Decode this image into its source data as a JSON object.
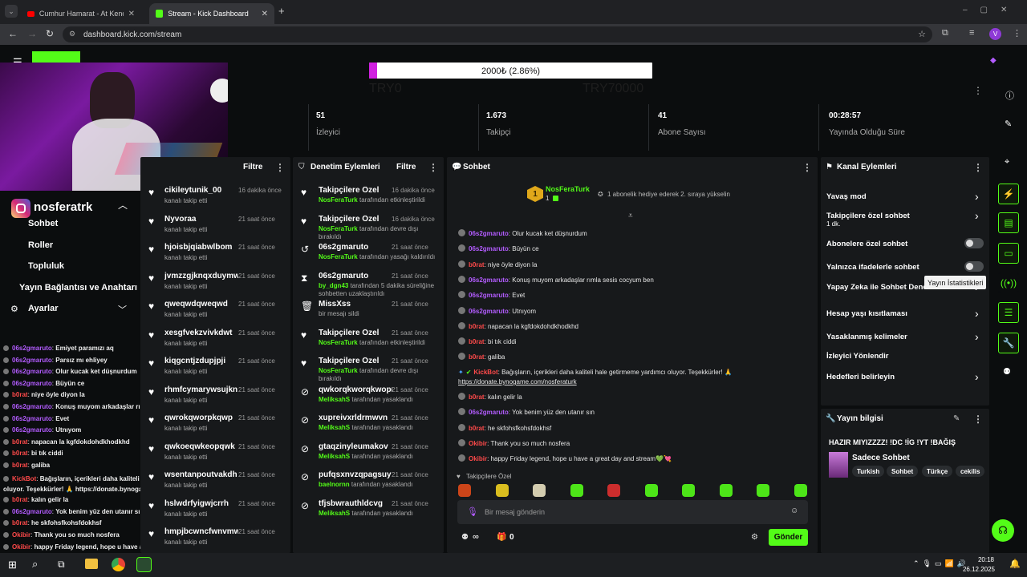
{
  "browser": {
    "tabs": [
      {
        "title": "Cumhur Hamarat - At Kendini D"
      },
      {
        "title": "Stream - Kick Dashboard"
      }
    ],
    "url": "dashboard.kick.com/stream",
    "profile_initial": "V"
  },
  "goal": {
    "bar_text": "2000₺ (2.86%)",
    "progress_fraction": 0.0286,
    "start_label": "TRY0",
    "end_label": "TRY70000"
  },
  "stats": [
    {
      "value": "51",
      "label": "İzleyici"
    },
    {
      "value": "1.673",
      "label": "Takipçi"
    },
    {
      "value": "41",
      "label": "Abone Sayısı"
    },
    {
      "value": "00:28:57",
      "label": "Yayında Olduğu Süre"
    }
  ],
  "left_nav": {
    "channel_name": "nosferatrk",
    "items": [
      "Sohbet",
      "Roller",
      "Topluluk",
      "Yayın Bağlantısı ve Anahtarı"
    ],
    "settings_label": "Ayarlar"
  },
  "activity": {
    "filter_label": "Filtre",
    "rows": [
      {
        "name": "cikileytunik_00",
        "sub": "kanalı takip etti",
        "time": "16 dakika önce"
      },
      {
        "name": "Nyvoraa",
        "sub": "kanalı takip etti",
        "time": "21 saat önce"
      },
      {
        "name": "hjoisbjqiabwlbom",
        "sub": "kanalı takip etti",
        "time": "21 saat önce"
      },
      {
        "name": "jvmzzgjknqxduymw",
        "sub": "kanalı takip etti",
        "time": "21 saat önce"
      },
      {
        "name": "qweqwdqweqwd",
        "sub": "kanalı takip etti",
        "time": "21 saat önce"
      },
      {
        "name": "xesgfvekzvivkdwt",
        "sub": "kanalı takip etti",
        "time": "21 saat önce"
      },
      {
        "name": "kiqgcntjzdupjpji",
        "sub": "kanalı takip etti",
        "time": "21 saat önce"
      },
      {
        "name": "rhmfcymarywsujkn",
        "sub": "kanalı takip etti",
        "time": "21 saat önce"
      },
      {
        "name": "qwrokqworpkqwp",
        "sub": "kanalı takip etti",
        "time": "21 saat önce"
      },
      {
        "name": "qwkoeqwkeopqwk",
        "sub": "kanalı takip etti",
        "time": "21 saat önce"
      },
      {
        "name": "wsentanpoutvakdh",
        "sub": "kanalı takip etti",
        "time": "21 saat önce"
      },
      {
        "name": "hslwdrfyigwjcrrh",
        "sub": "kanalı takip etti",
        "time": "21 saat önce"
      },
      {
        "name": "hmpjbcwncfwnvmwx",
        "sub": "kanalı takip etti",
        "time": "21 saat önce"
      }
    ]
  },
  "moderation": {
    "title": "Denetim Eylemleri",
    "filter_label": "Filtre",
    "rows": [
      {
        "icon": "heart-icon",
        "name": "Takipçilere Özel",
        "actor": "NosFeraTurk",
        "sub": "tarafından etkinleştirildi",
        "time": "16 dakika önce"
      },
      {
        "icon": "heart-icon",
        "name": "Takipçilere Özel",
        "actor": "NosFeraTurk",
        "sub": "tarafından devre dışı bırakıldı",
        "time": "16 dakika önce"
      },
      {
        "icon": "undo-icon",
        "name": "06s2gmaruto",
        "actor": "NosFeraTurk",
        "sub": "tarafından yasağı kaldırıldı",
        "time": "21 saat önce"
      },
      {
        "icon": "hourglass-icon",
        "name": "06s2gmaruto",
        "actor": "by_dgn43",
        "sub": "tarafından 5 dakika süreliğine sohbetten uzaklaştırıldı",
        "time": "21 saat önce"
      },
      {
        "icon": "trash-icon",
        "name": "MissXss",
        "actor": "",
        "sub": "bir mesajı sildi",
        "time": "21 saat önce"
      },
      {
        "icon": "heart-icon",
        "name": "Takipçilere Özel",
        "actor": "NosFeraTurk",
        "sub": "tarafından etkinleştirildi",
        "time": "21 saat önce"
      },
      {
        "icon": "heart-icon",
        "name": "Takipçilere Özel",
        "actor": "NosFeraTurk",
        "sub": "tarafından devre dışı bırakıldı",
        "time": "21 saat önce"
      },
      {
        "icon": "ban-icon",
        "name": "qwkorqkworqkwopr",
        "actor": "MeliksahS",
        "sub": "tarafından yasaklandı",
        "time": "21 saat önce"
      },
      {
        "icon": "ban-icon",
        "name": "xupreivxrldrmwvn",
        "actor": "MeliksahS",
        "sub": "tarafından yasaklandı",
        "time": "21 saat önce"
      },
      {
        "icon": "ban-icon",
        "name": "gtaqzinyleumakov",
        "actor": "MeliksahS",
        "sub": "tarafından yasaklandı",
        "time": "21 saat önce"
      },
      {
        "icon": "ban-icon",
        "name": "pufqsxnvzqpagsuy",
        "actor": "baelnornn",
        "sub": "tarafından yasaklandı",
        "time": "21 saat önce"
      },
      {
        "icon": "ban-icon",
        "name": "tfjsbwrauthldcvg",
        "actor": "MeliksahS",
        "sub": "tarafından yasaklandı",
        "time": "21 saat önce"
      }
    ]
  },
  "chat": {
    "title": "Sohbet",
    "pinned_user": "NosFeraTurk",
    "pinned_count": "1",
    "pinned_badge": "1",
    "pinned_text": "1 abonelik hediye ederek 2. sıraya yükselin",
    "messages": [
      {
        "user": "06s2gmaruto",
        "color": "purple",
        "text": "Olur kucak ket düşnurdum"
      },
      {
        "user": "06s2gmaruto",
        "color": "purple",
        "text": "Büyün ce"
      },
      {
        "user": "b0rat",
        "color": "red",
        "text": "niye öyle diyon la"
      },
      {
        "user": "06s2gmaruto",
        "color": "purple",
        "text": "Konuş muyom arkadaşlar rımla sesis cocyum ben"
      },
      {
        "user": "06s2gmaruto",
        "color": "purple",
        "text": "Evet"
      },
      {
        "user": "06s2gmaruto",
        "color": "purple",
        "text": "Utnıyom"
      },
      {
        "user": "b0rat",
        "color": "red",
        "text": "napacan la kgfdokdohdkhodkhd"
      },
      {
        "user": "b0rat",
        "color": "red",
        "text": "bi tık ciddi"
      },
      {
        "user": "b0rat",
        "color": "red",
        "text": "galiba"
      }
    ],
    "bot_user": "KickBot",
    "bot_text": "Bağışların, içerikleri daha kaliteli hale getirmeme yardımcı oluyor. Teşekkürler! 🙏",
    "bot_link": "https://donate.bynogame.com/nosferaturk",
    "messages2": [
      {
        "user": "b0rat",
        "color": "red",
        "text": "kalın gelir la"
      },
      {
        "user": "06s2gmaruto",
        "color": "purple",
        "text": "Yok benim yüz den utanır sın"
      },
      {
        "user": "b0rat",
        "color": "red",
        "text": "he skfohsfkohsfdokhsf"
      },
      {
        "user": "Okibir",
        "color": "red",
        "text": "Thank you so much nosfera"
      },
      {
        "user": "Okibir",
        "color": "red",
        "text": "happy Friday legend, hope u have a great day and stream💚💘"
      }
    ],
    "mode_label": "Takipçilere Özel",
    "input_placeholder": "Bir mesaj gönderin",
    "points_label": "∞",
    "gift_count": "0",
    "send_label": "Gönder"
  },
  "channel_actions": {
    "title": "Kanal Eylemleri",
    "items": [
      {
        "label": "Yavaş mod",
        "type": "chevron"
      },
      {
        "label": "Takipçilere özel sohbet",
        "sub": "1 dk.",
        "type": "chevron"
      },
      {
        "label": "Abonelere özel sohbet",
        "type": "toggle"
      },
      {
        "label": "Yalnızca ifadelerle sohbet",
        "type": "toggle"
      },
      {
        "label": "Yapay Zeka ile Sohbet Denetimi",
        "type": "chevron"
      },
      {
        "label": "Hesap yaşı kısıtlaması",
        "type": "chevron"
      },
      {
        "label": "Yasaklanmış kelimeler",
        "type": "chevron"
      },
      {
        "label": "İzleyici Yönlendir",
        "type": "none"
      },
      {
        "label": "Hedefleri belirleyin",
        "type": "chevron"
      }
    ],
    "tooltip": "Yayın İstatistikleri"
  },
  "stream_info": {
    "title": "Yayın bilgisi",
    "stream_title": "HAZIR MIYIZZZZ! !DC !İG !YT !BAĞIŞ",
    "category": "Sadece Sohbet",
    "tags": [
      "Turkish",
      "Sohbet",
      "Türkçe",
      "cekilis"
    ]
  },
  "overlay_chat": [
    {
      "user": "06s2gmaruto",
      "color": "purple",
      "text": "Emiyet paramızı aq"
    },
    {
      "user": "06s2gmaruto",
      "color": "purple",
      "text": "Parsız mı ehliyey"
    },
    {
      "user": "06s2gmaruto",
      "color": "purple",
      "text": "Olur kucak ket düşnurdum"
    },
    {
      "user": "06s2gmaruto",
      "color": "purple",
      "text": "Büyün ce"
    },
    {
      "user": "b0rat",
      "color": "red",
      "text": "niye öyle diyon la"
    },
    {
      "user": "06s2gmaruto",
      "color": "purple",
      "text": "Konuş muyom arkadaşlar rımla sesis cocyum ben"
    },
    {
      "user": "06s2gmaruto",
      "color": "purple",
      "text": "Evet"
    },
    {
      "user": "06s2gmaruto",
      "color": "purple",
      "text": "Utnıyom"
    },
    {
      "user": "b0rat",
      "color": "red",
      "text": "napacan la kgfdokdohdkhodkhd"
    },
    {
      "user": "b0rat",
      "color": "red",
      "text": "bi tık ciddi"
    },
    {
      "user": "b0rat",
      "color": "red",
      "text": "galiba"
    },
    {
      "user": "KickBot",
      "color": "red",
      "text": "Bağışların, içerikleri daha kaliteli hale getirmeme yardımcı oluyor. Teşekkürler! 🙏 https://donate.bynogame.com/nosferaturk"
    },
    {
      "user": "b0rat",
      "color": "red",
      "text": "kalın gelir la"
    },
    {
      "user": "06s2gmaruto",
      "color": "purple",
      "text": "Yok benim yüz den utanır sın"
    },
    {
      "user": "b0rat",
      "color": "red",
      "text": "he skfohsfkohsfdokhsf"
    },
    {
      "user": "Okibir",
      "color": "red",
      "text": "Thank you so much nosfera"
    },
    {
      "user": "Okibir",
      "color": "red",
      "text": "happy Friday legend, hope u have a great day and stream💚💘"
    }
  ],
  "taskbar": {
    "time": "20:18",
    "date": "26.12.2025"
  },
  "colors": {
    "accent": "#53fc18",
    "purple_user": "#b35cff",
    "red_user": "#ff4a4a",
    "goal_fill": "#d020e0"
  }
}
